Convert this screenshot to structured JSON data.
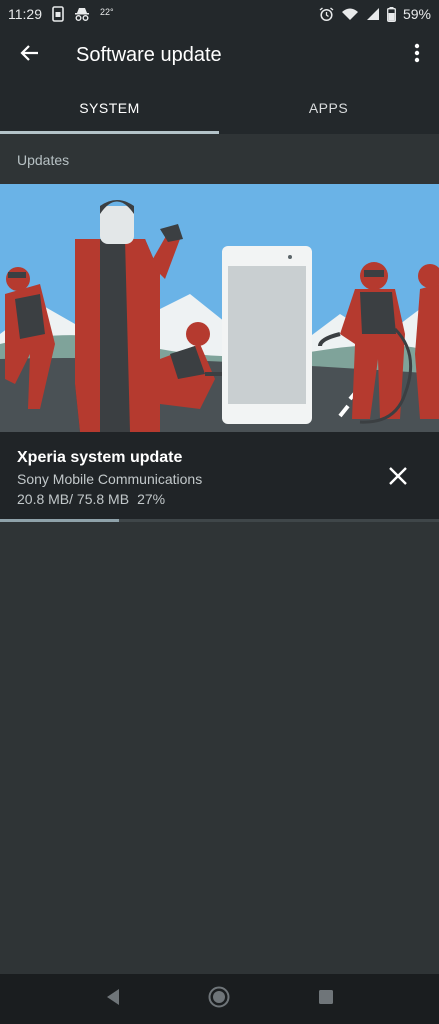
{
  "status_bar": {
    "time": "11:29",
    "temperature": "22°",
    "battery": "59%",
    "icons_left": [
      "sim-card-icon",
      "incognito-icon"
    ],
    "icons_right": [
      "alarm-icon",
      "wifi-icon",
      "signal-icon",
      "battery-icon"
    ]
  },
  "app_bar": {
    "title": "Software update",
    "back_icon": "arrow-back-icon",
    "menu_icon": "more-vert-icon"
  },
  "tabs": [
    {
      "label": "SYSTEM",
      "active": true
    },
    {
      "label": "APPS",
      "active": false
    }
  ],
  "section": {
    "title": "Updates"
  },
  "update": {
    "title": "Xperia system update",
    "publisher": "Sony Mobile Communications",
    "downloaded": "20.8 MB/ 75.8 MB",
    "percent_text": "27%",
    "progress": 0.27,
    "close_icon": "close-icon"
  },
  "nav_bar": {
    "icons": [
      "back-triangle-icon",
      "home-circle-icon",
      "recents-square-icon"
    ]
  },
  "colors": {
    "background": "#2f3436",
    "toolbar": "#23282b",
    "card": "#202427",
    "accent": "#b4c3c9",
    "progress": "#8fa2aa"
  }
}
